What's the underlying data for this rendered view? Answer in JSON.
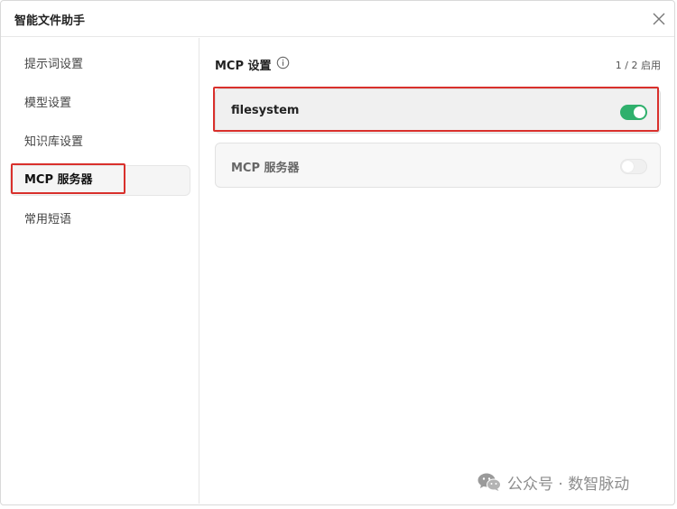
{
  "window": {
    "title": "智能文件助手"
  },
  "sidebar": {
    "items": [
      {
        "label": "提示词设置",
        "active": false
      },
      {
        "label": "模型设置",
        "active": false
      },
      {
        "label": "知识库设置",
        "active": false
      },
      {
        "label": "MCP 服务器",
        "active": true
      },
      {
        "label": "常用短语",
        "active": false
      }
    ]
  },
  "main": {
    "section_title": "MCP 设置",
    "count": "1 / 2 启用",
    "servers": [
      {
        "name": "filesystem",
        "enabled": true
      },
      {
        "name": "MCP 服务器",
        "enabled": false
      }
    ]
  },
  "watermark": {
    "text": "公众号 · 数智脉动"
  },
  "colors": {
    "toggle_on": "#2fb06c",
    "highlight_box": "#d9302c"
  }
}
